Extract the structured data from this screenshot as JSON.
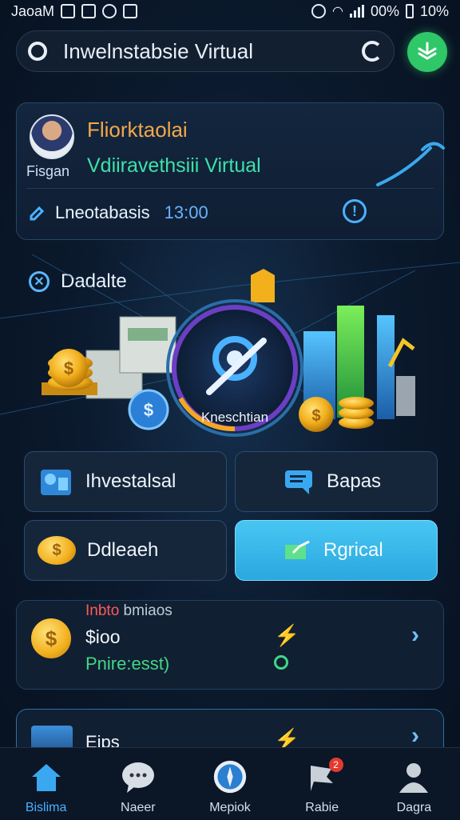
{
  "status_bar": {
    "left_text": "JaoaM",
    "battery_text": "00%",
    "battery_right": "10%"
  },
  "search": {
    "value": "Inwelnstabsie Virtual"
  },
  "profile": {
    "name": "Fliorktaolai",
    "subtitle": "Fisgan",
    "tagline": "Vdiiravethsiii Virtual",
    "row_label": "Lneotabasis",
    "row_time": "13:00"
  },
  "hero": {
    "title": "Dadalte",
    "center_label": "Kneschtian"
  },
  "grid": {
    "btn1": "Ihvestalsal",
    "btn2": "Bapas",
    "btn3": "Ddleaeh",
    "btn4": "Rgrical"
  },
  "balance": {
    "label_red": "Inbto",
    "label_gray": "bmiaos",
    "amount": "$ioo",
    "rate": "Pnire:esst)",
    "coin_symbol": "$"
  },
  "partial": {
    "label": "Eips"
  },
  "nav": {
    "items": [
      {
        "label": "Bislima",
        "icon": "home-icon"
      },
      {
        "label": "Naeer",
        "icon": "chat-icon"
      },
      {
        "label": "Mepiok",
        "icon": "compass-icon"
      },
      {
        "label": "Rabie",
        "icon": "flag-icon",
        "badge": "2"
      },
      {
        "label": "Dagra",
        "icon": "user-icon"
      }
    ]
  },
  "colors": {
    "accent": "#4ab2ff",
    "green": "#2fc767",
    "gold": "#f2a84a",
    "cyan_button": "#38b8ea"
  }
}
